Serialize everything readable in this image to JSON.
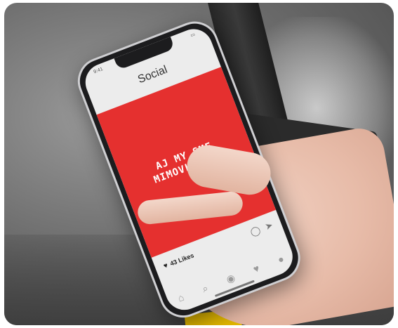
{
  "phone": {
    "status_time": "9:41",
    "app_title": "Social",
    "post_text": "AJ MY SME MIMOVLÁDKA!",
    "likes_label": "43 Likes"
  },
  "icons": {
    "likes": "heart-icon",
    "comment": "comment-icon",
    "share": "share-icon",
    "home": "home-icon",
    "search": "search-icon",
    "camera": "camera-icon",
    "activity": "heart-icon",
    "profile": "profile-icon"
  },
  "colors": {
    "post_background": "#e5302f",
    "post_text": "#ffffff",
    "screen_background": "#ececec"
  }
}
